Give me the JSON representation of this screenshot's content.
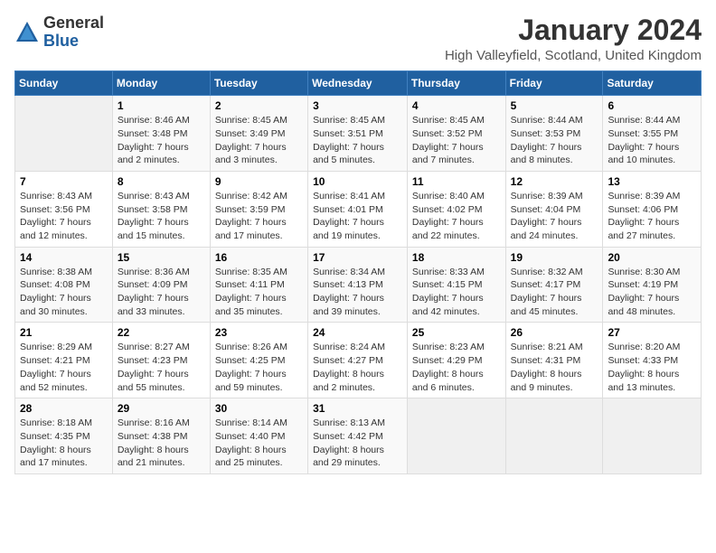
{
  "header": {
    "logo_general": "General",
    "logo_blue": "Blue",
    "month": "January 2024",
    "location": "High Valleyfield, Scotland, United Kingdom"
  },
  "days_of_week": [
    "Sunday",
    "Monday",
    "Tuesday",
    "Wednesday",
    "Thursday",
    "Friday",
    "Saturday"
  ],
  "weeks": [
    [
      {
        "day": "",
        "sunrise": "",
        "sunset": "",
        "daylight": ""
      },
      {
        "day": "1",
        "sunrise": "Sunrise: 8:46 AM",
        "sunset": "Sunset: 3:48 PM",
        "daylight": "Daylight: 7 hours and 2 minutes."
      },
      {
        "day": "2",
        "sunrise": "Sunrise: 8:45 AM",
        "sunset": "Sunset: 3:49 PM",
        "daylight": "Daylight: 7 hours and 3 minutes."
      },
      {
        "day": "3",
        "sunrise": "Sunrise: 8:45 AM",
        "sunset": "Sunset: 3:51 PM",
        "daylight": "Daylight: 7 hours and 5 minutes."
      },
      {
        "day": "4",
        "sunrise": "Sunrise: 8:45 AM",
        "sunset": "Sunset: 3:52 PM",
        "daylight": "Daylight: 7 hours and 7 minutes."
      },
      {
        "day": "5",
        "sunrise": "Sunrise: 8:44 AM",
        "sunset": "Sunset: 3:53 PM",
        "daylight": "Daylight: 7 hours and 8 minutes."
      },
      {
        "day": "6",
        "sunrise": "Sunrise: 8:44 AM",
        "sunset": "Sunset: 3:55 PM",
        "daylight": "Daylight: 7 hours and 10 minutes."
      }
    ],
    [
      {
        "day": "7",
        "sunrise": "Sunrise: 8:43 AM",
        "sunset": "Sunset: 3:56 PM",
        "daylight": "Daylight: 7 hours and 12 minutes."
      },
      {
        "day": "8",
        "sunrise": "Sunrise: 8:43 AM",
        "sunset": "Sunset: 3:58 PM",
        "daylight": "Daylight: 7 hours and 15 minutes."
      },
      {
        "day": "9",
        "sunrise": "Sunrise: 8:42 AM",
        "sunset": "Sunset: 3:59 PM",
        "daylight": "Daylight: 7 hours and 17 minutes."
      },
      {
        "day": "10",
        "sunrise": "Sunrise: 8:41 AM",
        "sunset": "Sunset: 4:01 PM",
        "daylight": "Daylight: 7 hours and 19 minutes."
      },
      {
        "day": "11",
        "sunrise": "Sunrise: 8:40 AM",
        "sunset": "Sunset: 4:02 PM",
        "daylight": "Daylight: 7 hours and 22 minutes."
      },
      {
        "day": "12",
        "sunrise": "Sunrise: 8:39 AM",
        "sunset": "Sunset: 4:04 PM",
        "daylight": "Daylight: 7 hours and 24 minutes."
      },
      {
        "day": "13",
        "sunrise": "Sunrise: 8:39 AM",
        "sunset": "Sunset: 4:06 PM",
        "daylight": "Daylight: 7 hours and 27 minutes."
      }
    ],
    [
      {
        "day": "14",
        "sunrise": "Sunrise: 8:38 AM",
        "sunset": "Sunset: 4:08 PM",
        "daylight": "Daylight: 7 hours and 30 minutes."
      },
      {
        "day": "15",
        "sunrise": "Sunrise: 8:36 AM",
        "sunset": "Sunset: 4:09 PM",
        "daylight": "Daylight: 7 hours and 33 minutes."
      },
      {
        "day": "16",
        "sunrise": "Sunrise: 8:35 AM",
        "sunset": "Sunset: 4:11 PM",
        "daylight": "Daylight: 7 hours and 35 minutes."
      },
      {
        "day": "17",
        "sunrise": "Sunrise: 8:34 AM",
        "sunset": "Sunset: 4:13 PM",
        "daylight": "Daylight: 7 hours and 39 minutes."
      },
      {
        "day": "18",
        "sunrise": "Sunrise: 8:33 AM",
        "sunset": "Sunset: 4:15 PM",
        "daylight": "Daylight: 7 hours and 42 minutes."
      },
      {
        "day": "19",
        "sunrise": "Sunrise: 8:32 AM",
        "sunset": "Sunset: 4:17 PM",
        "daylight": "Daylight: 7 hours and 45 minutes."
      },
      {
        "day": "20",
        "sunrise": "Sunrise: 8:30 AM",
        "sunset": "Sunset: 4:19 PM",
        "daylight": "Daylight: 7 hours and 48 minutes."
      }
    ],
    [
      {
        "day": "21",
        "sunrise": "Sunrise: 8:29 AM",
        "sunset": "Sunset: 4:21 PM",
        "daylight": "Daylight: 7 hours and 52 minutes."
      },
      {
        "day": "22",
        "sunrise": "Sunrise: 8:27 AM",
        "sunset": "Sunset: 4:23 PM",
        "daylight": "Daylight: 7 hours and 55 minutes."
      },
      {
        "day": "23",
        "sunrise": "Sunrise: 8:26 AM",
        "sunset": "Sunset: 4:25 PM",
        "daylight": "Daylight: 7 hours and 59 minutes."
      },
      {
        "day": "24",
        "sunrise": "Sunrise: 8:24 AM",
        "sunset": "Sunset: 4:27 PM",
        "daylight": "Daylight: 8 hours and 2 minutes."
      },
      {
        "day": "25",
        "sunrise": "Sunrise: 8:23 AM",
        "sunset": "Sunset: 4:29 PM",
        "daylight": "Daylight: 8 hours and 6 minutes."
      },
      {
        "day": "26",
        "sunrise": "Sunrise: 8:21 AM",
        "sunset": "Sunset: 4:31 PM",
        "daylight": "Daylight: 8 hours and 9 minutes."
      },
      {
        "day": "27",
        "sunrise": "Sunrise: 8:20 AM",
        "sunset": "Sunset: 4:33 PM",
        "daylight": "Daylight: 8 hours and 13 minutes."
      }
    ],
    [
      {
        "day": "28",
        "sunrise": "Sunrise: 8:18 AM",
        "sunset": "Sunset: 4:35 PM",
        "daylight": "Daylight: 8 hours and 17 minutes."
      },
      {
        "day": "29",
        "sunrise": "Sunrise: 8:16 AM",
        "sunset": "Sunset: 4:38 PM",
        "daylight": "Daylight: 8 hours and 21 minutes."
      },
      {
        "day": "30",
        "sunrise": "Sunrise: 8:14 AM",
        "sunset": "Sunset: 4:40 PM",
        "daylight": "Daylight: 8 hours and 25 minutes."
      },
      {
        "day": "31",
        "sunrise": "Sunrise: 8:13 AM",
        "sunset": "Sunset: 4:42 PM",
        "daylight": "Daylight: 8 hours and 29 minutes."
      },
      {
        "day": "",
        "sunrise": "",
        "sunset": "",
        "daylight": ""
      },
      {
        "day": "",
        "sunrise": "",
        "sunset": "",
        "daylight": ""
      },
      {
        "day": "",
        "sunrise": "",
        "sunset": "",
        "daylight": ""
      }
    ]
  ]
}
